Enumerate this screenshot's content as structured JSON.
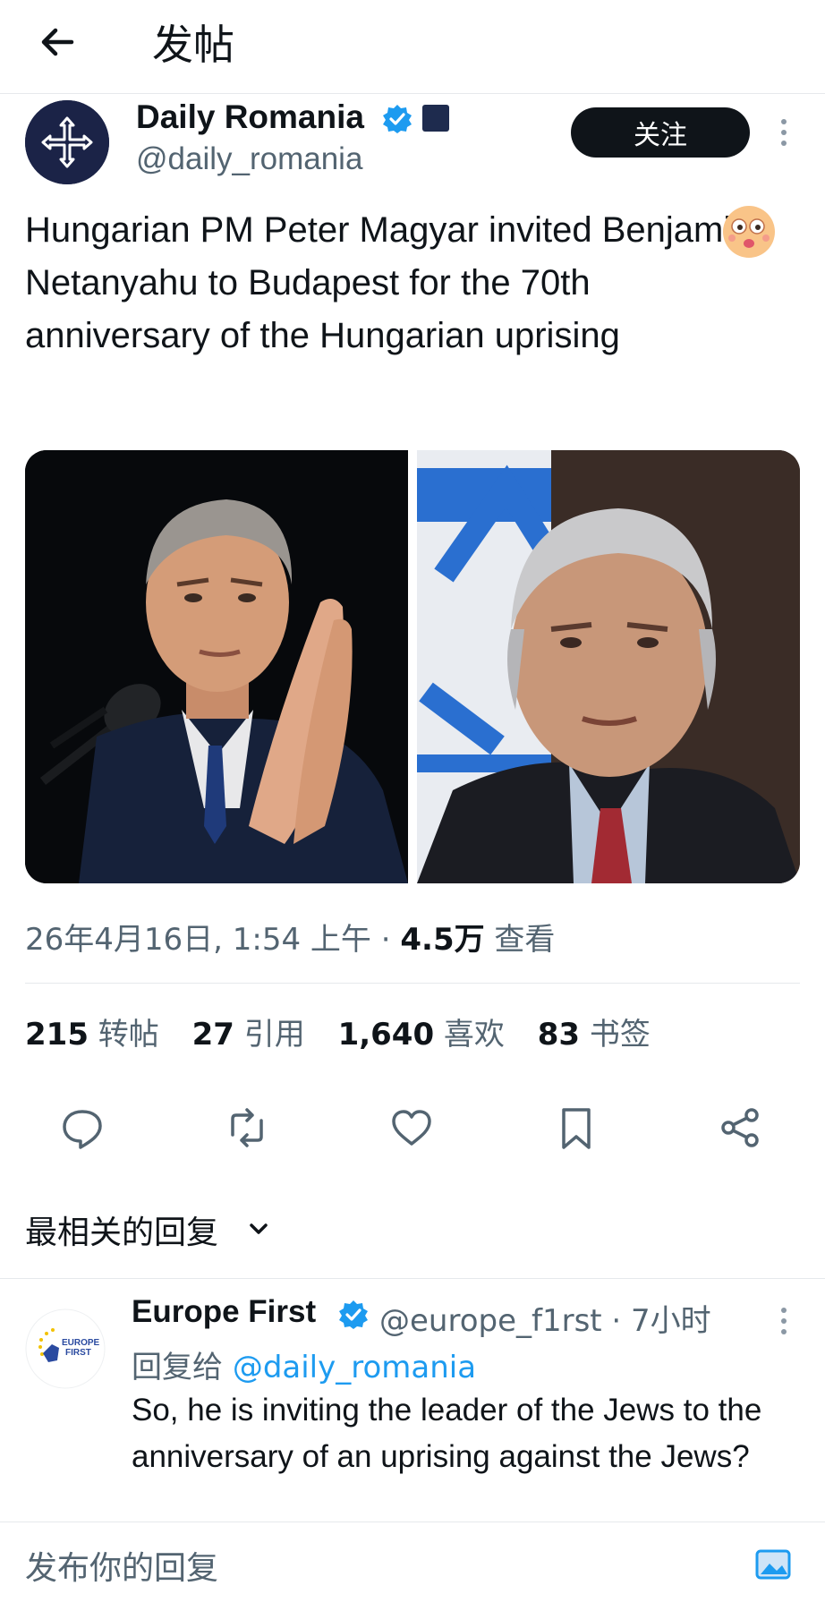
{
  "header": {
    "title": "发帖"
  },
  "post": {
    "author_name": "Daily Romania",
    "author_handle": "@daily_romania",
    "follow_label": "关注",
    "text": "Hungarian PM Peter Magyar invited Benjamin Netanyahu to Budapest for the 70th anniversary of the Hungarian uprising",
    "timestamp": "26年4月16日, 1:54 上午",
    "separator": " · ",
    "views_count": "4.5万",
    "views_label": " 查看",
    "stats": {
      "reposts_count": "215",
      "reposts_label": "转帖",
      "quotes_count": "27",
      "quotes_label": "引用",
      "likes_count": "1,640",
      "likes_label": "喜欢",
      "bookmarks_count": "83",
      "bookmarks_label": "书签"
    }
  },
  "replies": {
    "sort_label": "最相关的回复",
    "items": [
      {
        "name": "Europe First",
        "handle_time": "@europe_f1rst · 7小时",
        "reply_to_prefix": "回复给 ",
        "reply_to_handle": "@daily_romania",
        "text": "So, he is inviting the leader of the Jews to the anniversary of an uprising against the Jews?",
        "avatar_text_1": "EUROPE",
        "avatar_text_2": "FIRST"
      }
    ]
  },
  "compose": {
    "placeholder": "发布你的回复"
  },
  "colors": {
    "accent": "#1d9bf0",
    "verified": "#1d9bf0",
    "muted": "#536471",
    "text": "#0f1419"
  },
  "icons": [
    "back-arrow-icon",
    "verified-badge-icon",
    "affiliate-badge-icon",
    "more-options-icon",
    "emoji-face-icon",
    "reply-icon",
    "repost-icon",
    "like-icon",
    "bookmark-icon",
    "share-icon",
    "chevron-down-icon",
    "compose-media-icon"
  ]
}
